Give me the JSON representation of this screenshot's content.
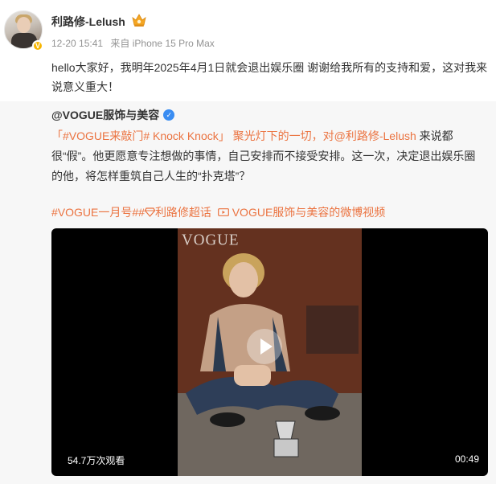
{
  "post": {
    "username": "利路修-Lelush",
    "timestamp": "12-20 15:41",
    "source": "来自 iPhone 15 Pro Max",
    "text": "hello大家好，我明年2025年4月1日就会退出娱乐圈 谢谢给我所有的支持和爱，这对我来说意义重大！"
  },
  "repost": {
    "author": "@VOGUE服饰与美容",
    "text_1": "「#VOGUE来敲门# Knock Knock」 聚光灯下的一切，对",
    "mention": "@利路修-Lelush",
    "text_2": " 来说都很“假”。他更愿意专注想做的事情，自己安排而不接受安排。这一次，决定退出娱乐圈的他，将怎样重筑自己人生的“扑克塔”？",
    "topic_1": "#VOGUE一月号#",
    "topic_2": "利路修超话",
    "topic_3": "VOGUE服饰与美容的微博视频"
  },
  "video": {
    "poster_logo": "VOGUE",
    "views": "54.7万次观看",
    "duration": "00:49"
  },
  "colors": {
    "link": "#eb7340",
    "verified_blue": "#3a8df2",
    "verified_gold": "#f7b500",
    "repost_bg": "#f7f7f7"
  },
  "icons": [
    "avatar",
    "verified-badge-icon",
    "crown-icon",
    "verified-check-icon",
    "diamond-icon",
    "video-icon",
    "play-icon"
  ]
}
